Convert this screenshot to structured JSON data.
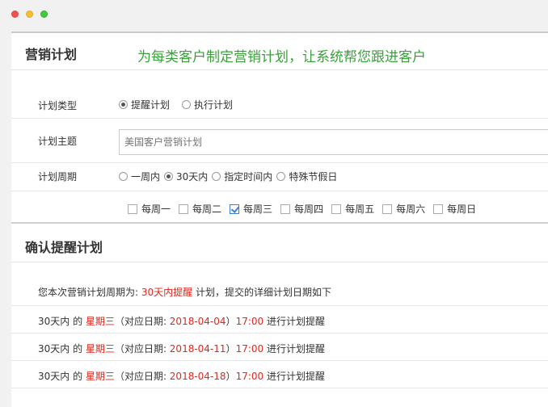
{
  "window": {
    "controls": [
      "close",
      "minimize",
      "zoom"
    ]
  },
  "plan_section": {
    "title": "营销计划",
    "slogan": "为每类客户制定营销计划，让系统帮您跟进客户"
  },
  "form": {
    "type": {
      "label": "计划类型",
      "options": [
        "提醒计划",
        "执行计划"
      ],
      "selected": "提醒计划"
    },
    "subject": {
      "label": "计划主题",
      "value": "",
      "placeholder": "美国客户营销计划"
    },
    "cycle": {
      "label": "计划周期",
      "options": [
        "一周内",
        "30天内",
        "指定时间内",
        "特殊节假日"
      ],
      "selected": "30天内"
    },
    "weekdays": {
      "options": [
        "每周一",
        "每周二",
        "每周三",
        "每周四",
        "每周五",
        "每周六",
        "每周日"
      ],
      "checked": [
        "每周三"
      ]
    }
  },
  "confirm_section": {
    "title": "确认提醒计划",
    "summary": {
      "prefix": "您本次营销计划周期为: ",
      "highlight": "30天内提醒",
      "suffix": " 计划，提交的详细计划日期如下"
    },
    "entries": [
      {
        "period": "30天内",
        "of": " 的 ",
        "weekday": "星期三",
        "mid": "（对应日期: ",
        "date": "2018-04-04",
        "close": "）",
        "time": "17:00",
        "action": " 进行计划提醒"
      },
      {
        "period": "30天内",
        "of": " 的 ",
        "weekday": "星期三",
        "mid": "（对应日期: ",
        "date": "2018-04-11",
        "close": "）",
        "time": "17:00",
        "action": " 进行计划提醒"
      },
      {
        "period": "30天内",
        "of": " 的 ",
        "weekday": "星期三",
        "mid": "（对应日期: ",
        "date": "2018-04-18",
        "close": "）",
        "time": "17:00",
        "action": " 进行计划提醒"
      }
    ]
  },
  "colors": {
    "slogan": "#3aa13a",
    "highlight": "#e0261e",
    "checkbox_accent": "#3b7dd8"
  }
}
